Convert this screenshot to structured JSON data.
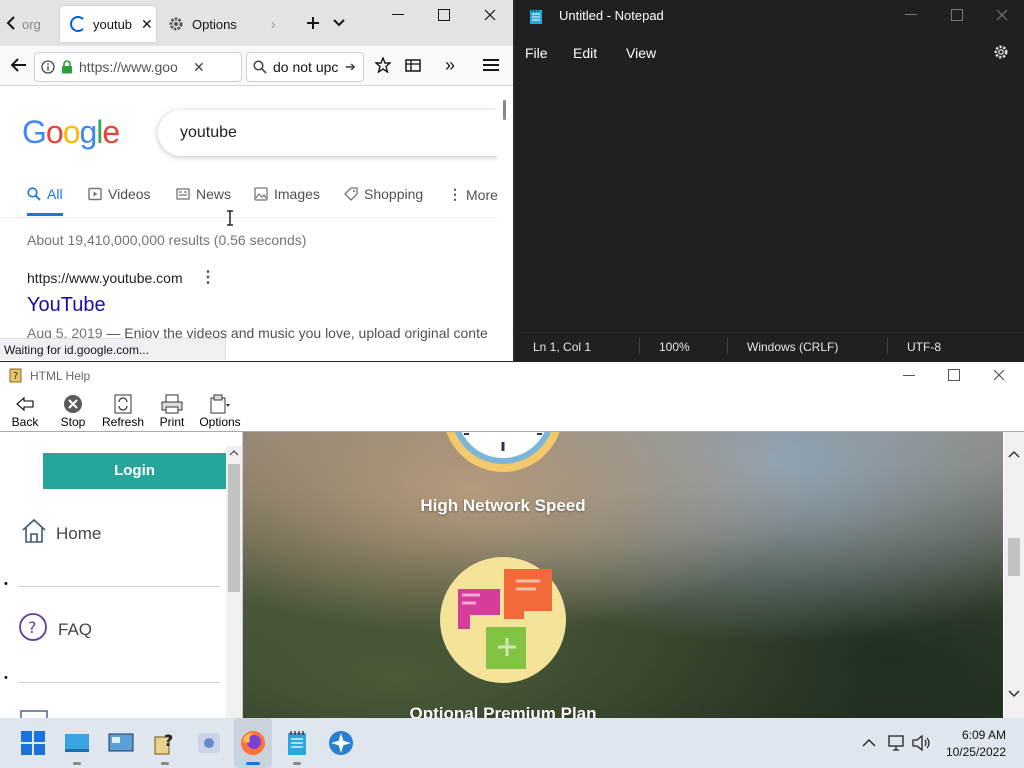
{
  "firefox": {
    "tabs": [
      {
        "label": "org",
        "partial": true
      },
      {
        "label": "youtub",
        "active": true
      },
      {
        "label": "Options"
      }
    ],
    "url": "https://www.goo",
    "search_text": "do not upc",
    "status_text": "Waiting for id.google.com...",
    "google": {
      "logo": "Google",
      "query": "youtube",
      "nav": [
        {
          "label": "All",
          "icon": "search-icon",
          "active": true
        },
        {
          "label": "Videos",
          "icon": "video-icon"
        },
        {
          "label": "News",
          "icon": "news-icon"
        },
        {
          "label": "Images",
          "icon": "image-icon"
        },
        {
          "label": "Shopping",
          "icon": "tag-icon"
        },
        {
          "label": "More",
          "icon": "more-vertical-icon"
        }
      ],
      "results_count": "About 19,410,000,000 results (0.56 seconds)",
      "result": {
        "cite": "https://www.youtube.com",
        "title": "YouTube",
        "snippet_date": "Aug 5, 2019",
        "snippet": " — Enjoy the videos and music you love, upload original conte"
      }
    }
  },
  "notepad": {
    "title": "Untitled - Notepad",
    "menu": [
      "File",
      "Edit",
      "View"
    ],
    "status": {
      "position": "Ln 1, Col 1",
      "zoom": "100%",
      "line_ending": "Windows (CRLF)",
      "encoding": "UTF-8"
    }
  },
  "html_help": {
    "title": "HTML Help",
    "toolbar": [
      "Back",
      "Stop",
      "Refresh",
      "Print",
      "Options"
    ],
    "sidebar": {
      "login_label": "Login",
      "items": [
        {
          "label": "Home",
          "icon": "home-icon"
        },
        {
          "label": "FAQ",
          "icon": "question-circle-icon"
        }
      ]
    },
    "content": {
      "feature1": "High Network Speed",
      "feature2": "Optional Premium Plan"
    }
  },
  "taskbar": {
    "time": "6:09 AM",
    "date": "10/25/2022"
  },
  "colors": {
    "google_blue": "#1a0dab",
    "teal": "#26a69a",
    "notepad_bg": "#202020"
  }
}
